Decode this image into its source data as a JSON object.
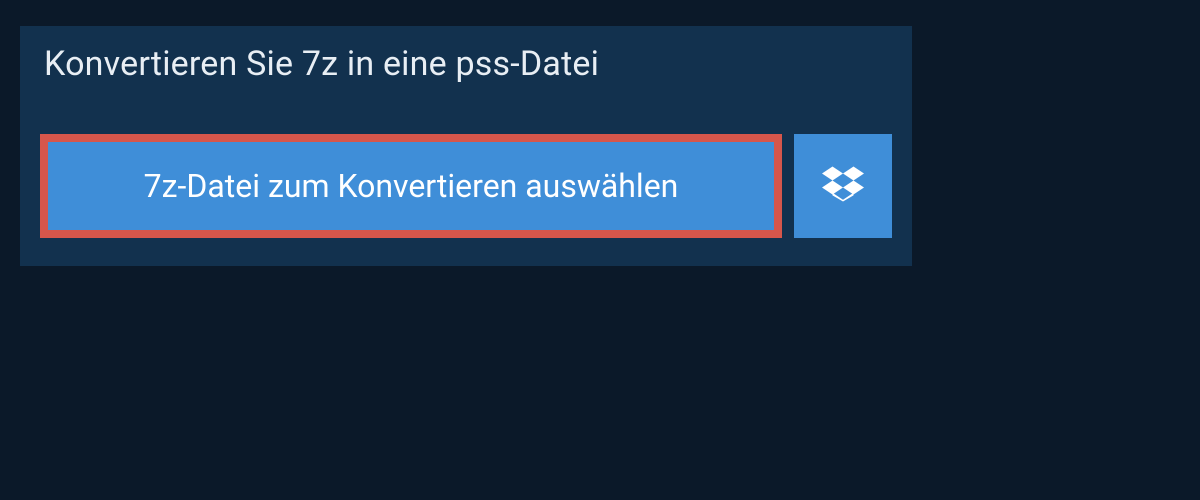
{
  "panel": {
    "title": "Konvertieren Sie 7z in eine pss-Datei",
    "selectButton": {
      "label": "7z-Datei zum Konvertieren auswählen"
    }
  }
}
